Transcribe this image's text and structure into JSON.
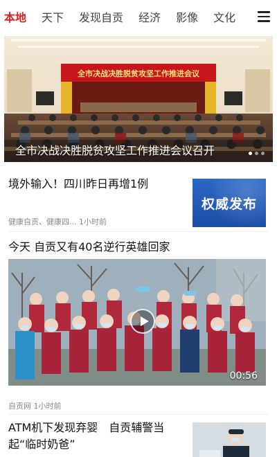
{
  "tabs": [
    {
      "label": "本地",
      "active": true
    },
    {
      "label": "天下",
      "active": false
    },
    {
      "label": "发现自贡",
      "active": false
    },
    {
      "label": "经济",
      "active": false
    },
    {
      "label": "影像",
      "active": false
    },
    {
      "label": "文化",
      "active": false
    }
  ],
  "menu_icon": "hamburger-menu-icon",
  "hero": {
    "caption": "全市决战决胜脱贫攻坚工作推进会议召开",
    "banner_text": "全市决战决胜脱贫攻坚工作推进会议",
    "slide_count": 3,
    "active_slide": 1
  },
  "news": [
    {
      "title": "境外输入！四川昨日再增1例",
      "meta": "健康自贡、健康四...   1小时前",
      "thumb_text": "权威发布"
    },
    {
      "title": "今天 自贡又有40名逆行英雄回家",
      "video_duration": "00:56",
      "meta": "自贡网   1小时前"
    },
    {
      "title": "ATM机下发现弃婴　自贡辅警当起“临时奶爸”"
    }
  ],
  "colors": {
    "accent": "#e02020",
    "banner_red": "#c8161d",
    "thumb_blue": "#2a67c5"
  }
}
